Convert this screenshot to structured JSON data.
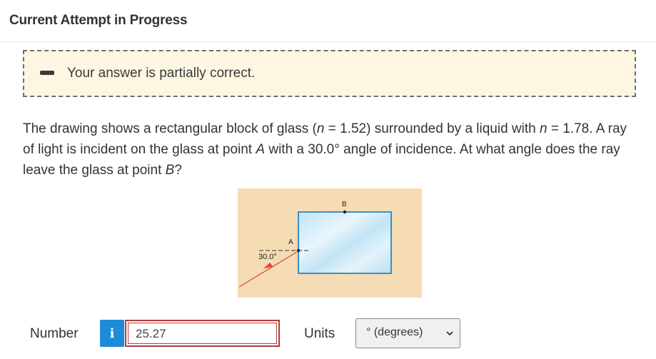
{
  "header": {
    "title": "Current Attempt in Progress"
  },
  "feedback": {
    "message": "Your answer is partially correct."
  },
  "question": {
    "part1": "The drawing shows a rectangular block of glass (",
    "n1_var": "n",
    "part2": " = 1.52) surrounded by a liquid with ",
    "n2_var": "n",
    "part3": " = 1.78. A ray of light is incident on the glass at point ",
    "pointA": "A",
    "part4": " with a 30.0° angle of incidence. At what angle does the ray leave the glass at point ",
    "pointB": "B",
    "part5": "?"
  },
  "figure": {
    "label_A": "A",
    "label_B": "B",
    "angle_label": "30.0°",
    "colors": {
      "liquid": "#f6dcb4",
      "glass": "#cfe9f7",
      "glass_border": "#3b8fc7",
      "ray": "#e24a3a"
    }
  },
  "answer": {
    "number_label": "Number",
    "info_icon": "i",
    "value": "25.27",
    "units_label": "Units",
    "units_selected": "° (degrees)"
  }
}
